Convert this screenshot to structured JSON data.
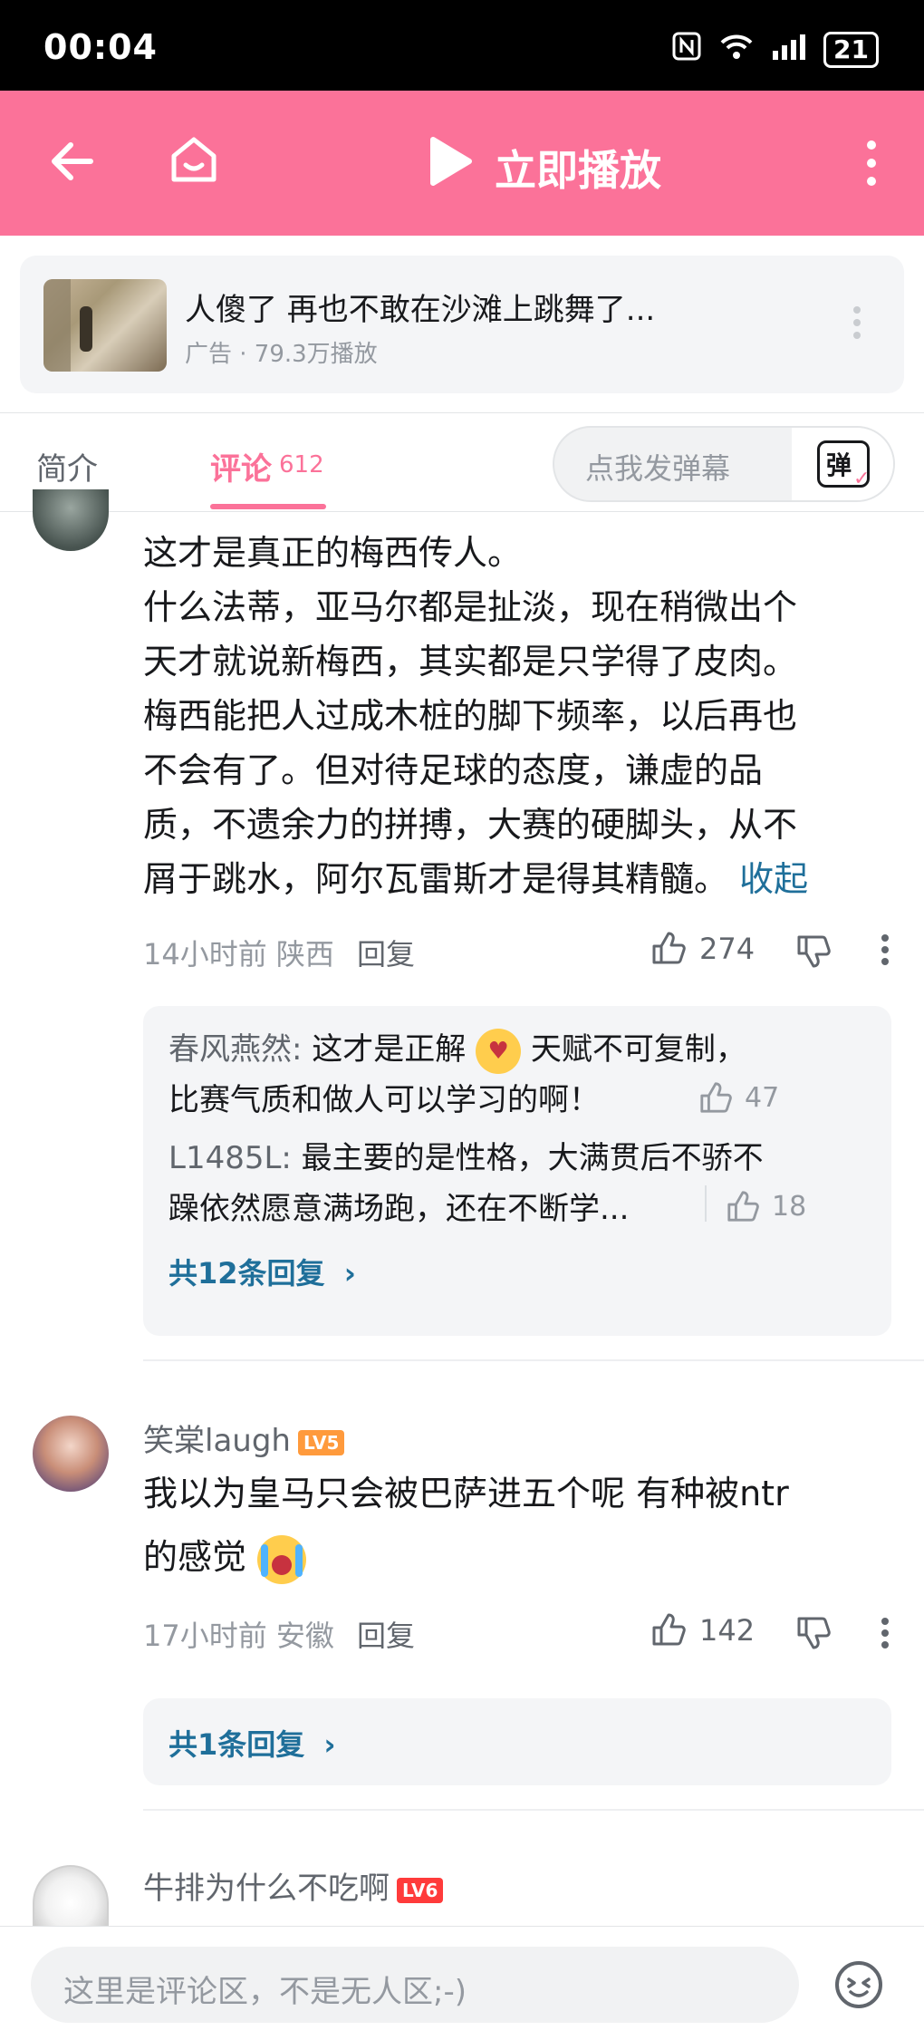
{
  "status_bar": {
    "time": "00:04",
    "battery": "21"
  },
  "header": {
    "play_label": "立即播放"
  },
  "ad": {
    "title": "人傻了 再也不敢在沙滩上跳舞了...",
    "meta": "广告 · 79.3万播放"
  },
  "tabs": {
    "intro": "简介",
    "comments": "评论",
    "comments_count": "612",
    "danmaku_placeholder": "点我发弹幕",
    "danmaku_btn": "弹"
  },
  "comment1": {
    "lines": [
      "这才是真正的梅西传人。",
      "什么法蒂，亚马尔都是扯淡，现在稍微出个",
      "天才就说新梅西，其实都是只学得了皮肉。",
      "梅西能把人过成木桩的脚下频率，以后再也",
      "不会有了。但对待足球的态度，谦虚的品",
      "质，不遗余力的拼搏，大赛的硬脚头，从不"
    ],
    "last_line": "屑于跳水，阿尔瓦雷斯才是得其精髓。",
    "collapse": "收起",
    "time_location": "14小时前 陕西",
    "reply": "回复",
    "likes": "274",
    "sub_replies": [
      {
        "name": "春风燕然:",
        "text1": " 这才是正解",
        "text2": " 天赋不可复制，",
        "text3": "比赛气质和做人可以学习的啊！",
        "likes": "47"
      },
      {
        "name": "L1485L:",
        "text1": " 最主要的是性格，大满贯后不骄不",
        "text3": "躁依然愿意满场跑，还在不断学...",
        "likes": "18"
      }
    ],
    "more_replies": "共12条回复"
  },
  "comment2": {
    "username": "笑棠laugh",
    "level": "LV5",
    "line1": "我以为皇马只会被巴萨进五个呢  有种被ntr",
    "line2": "的感觉",
    "time_location": "17小时前 安徽",
    "reply": "回复",
    "likes": "142",
    "more_replies": "共1条回复"
  },
  "comment3": {
    "username": "牛排为什么不吃啊",
    "level": "LV6"
  },
  "bottom": {
    "input_placeholder": "这里是评论区，不是无人区;-)"
  },
  "colors": {
    "brand_pink": "#fb7299",
    "link_blue": "#1f6f9a"
  }
}
